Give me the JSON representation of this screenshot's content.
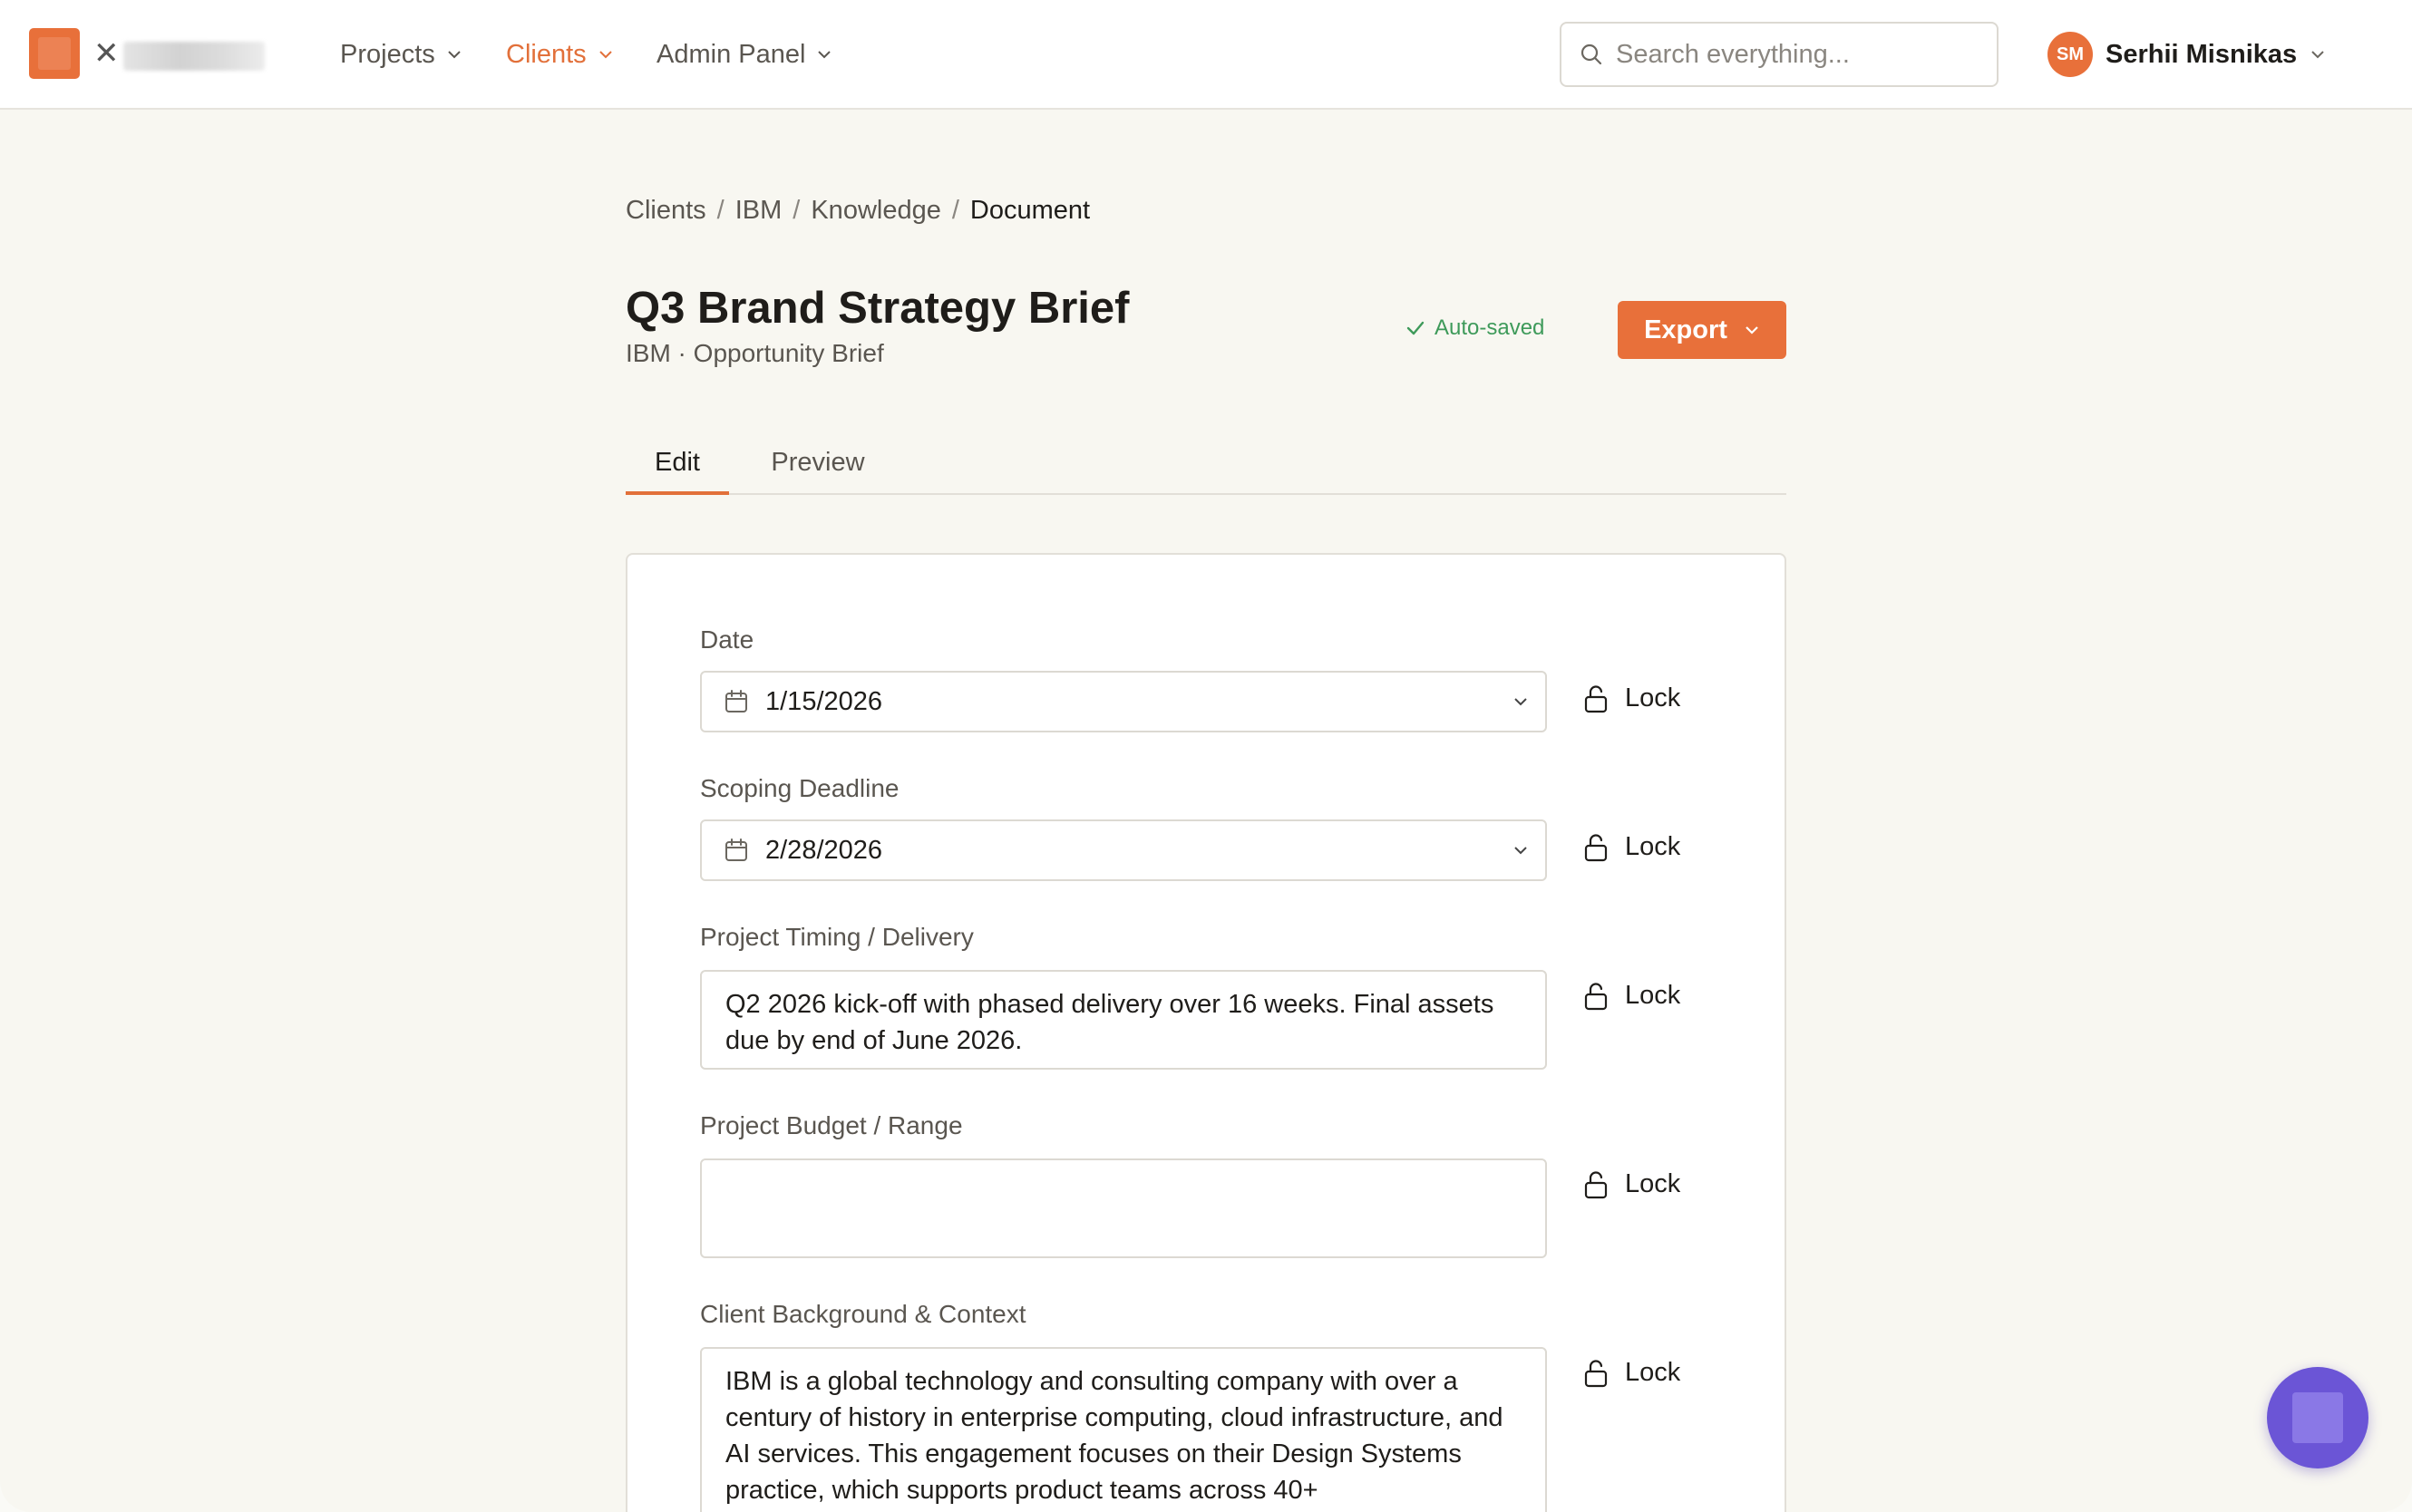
{
  "topbar": {
    "close_glyph": "✕",
    "nav": [
      {
        "label": "Projects",
        "active": false
      },
      {
        "label": "Clients",
        "active": true
      },
      {
        "label": "Admin Panel",
        "active": false
      }
    ],
    "search_placeholder": "Search everything...",
    "user": {
      "initials": "SM",
      "name": "Serhii Misnikas"
    }
  },
  "breadcrumb": [
    "Clients",
    "IBM",
    "Knowledge",
    "Document"
  ],
  "breadcrumb_separator": "/",
  "document": {
    "title": "Q3 Brand Strategy Brief",
    "subtitle": "IBM · Opportunity Brief",
    "status": "Auto-saved",
    "export_label": "Export"
  },
  "tabs": [
    {
      "label": "Edit",
      "active": true
    },
    {
      "label": "Preview",
      "active": false
    }
  ],
  "fields": {
    "date": {
      "label": "Date",
      "value": "1/15/2026"
    },
    "scoping_deadline": {
      "label": "Scoping Deadline",
      "value": "2/28/2026"
    },
    "project_timing": {
      "label": "Project Timing / Delivery",
      "value": "Q2 2026 kick-off with phased delivery over 16 weeks. Final assets due by end of June 2026."
    },
    "project_budget": {
      "label": "Project Budget / Range",
      "value": ""
    },
    "client_background": {
      "label": "Client Background & Context",
      "value": "IBM is a global technology and consulting company with over a century of history in enterprise computing, cloud infrastructure, and AI services. This engagement focuses on their Design Systems practice, which supports product teams across 40+"
    }
  },
  "lock_label": "Lock",
  "colors": {
    "accent": "#e8703a",
    "success": "#3e9a5a",
    "chat_fab": "#6b55d6"
  }
}
